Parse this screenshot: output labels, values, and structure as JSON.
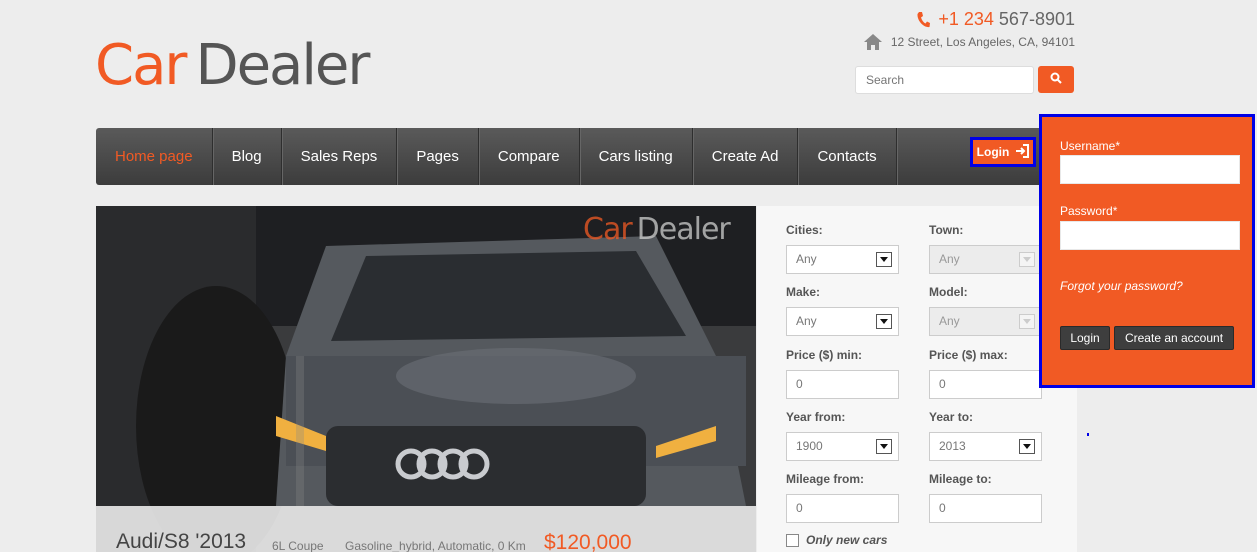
{
  "header": {
    "logo_part1": "Car",
    "logo_part2": "Dealer",
    "phone_code": "+1 234",
    "phone_number": "567-8901",
    "address": "12 Street, Los Angeles, CA, 94101",
    "search_placeholder": "Search"
  },
  "nav": {
    "items": [
      "Home page",
      "Blog",
      "Sales Reps",
      "Pages",
      "Compare",
      "Cars listing",
      "Create Ad",
      "Contacts"
    ],
    "login_label": "Login"
  },
  "hero": {
    "watermark_part1": "Car",
    "watermark_part2": "Dealer",
    "car_title": "Audi/S8 '2013",
    "engine": "6L Coupe",
    "fuel_info": "Gasoline_hybrid, Automatic, 0 Km",
    "price": "$120,000"
  },
  "filters": {
    "cities_label": "Cities:",
    "cities_value": "Any",
    "town_label": "Town:",
    "town_value": "Any",
    "make_label": "Make:",
    "make_value": "Any",
    "model_label": "Model:",
    "model_value": "Any",
    "price_min_label": "Price ($) min:",
    "price_min_value": "0",
    "price_max_label": "Price ($) max:",
    "price_max_value": "0",
    "year_from_label": "Year from:",
    "year_from_value": "1900",
    "year_to_label": "Year to:",
    "year_to_value": "2013",
    "mileage_from_label": "Mileage from:",
    "mileage_from_value": "0",
    "mileage_to_label": "Mileage to:",
    "mileage_to_value": "0",
    "only_new_label": "Only new cars"
  },
  "login_panel": {
    "username_label": "Username*",
    "password_label": "Password*",
    "forgot_label": "Forgot your password?",
    "login_button": "Login",
    "create_account_button": "Create an account"
  },
  "colors": {
    "accent": "#f15a24",
    "highlight_border": "#0000e6",
    "nav_background": "#4a4a4a"
  }
}
